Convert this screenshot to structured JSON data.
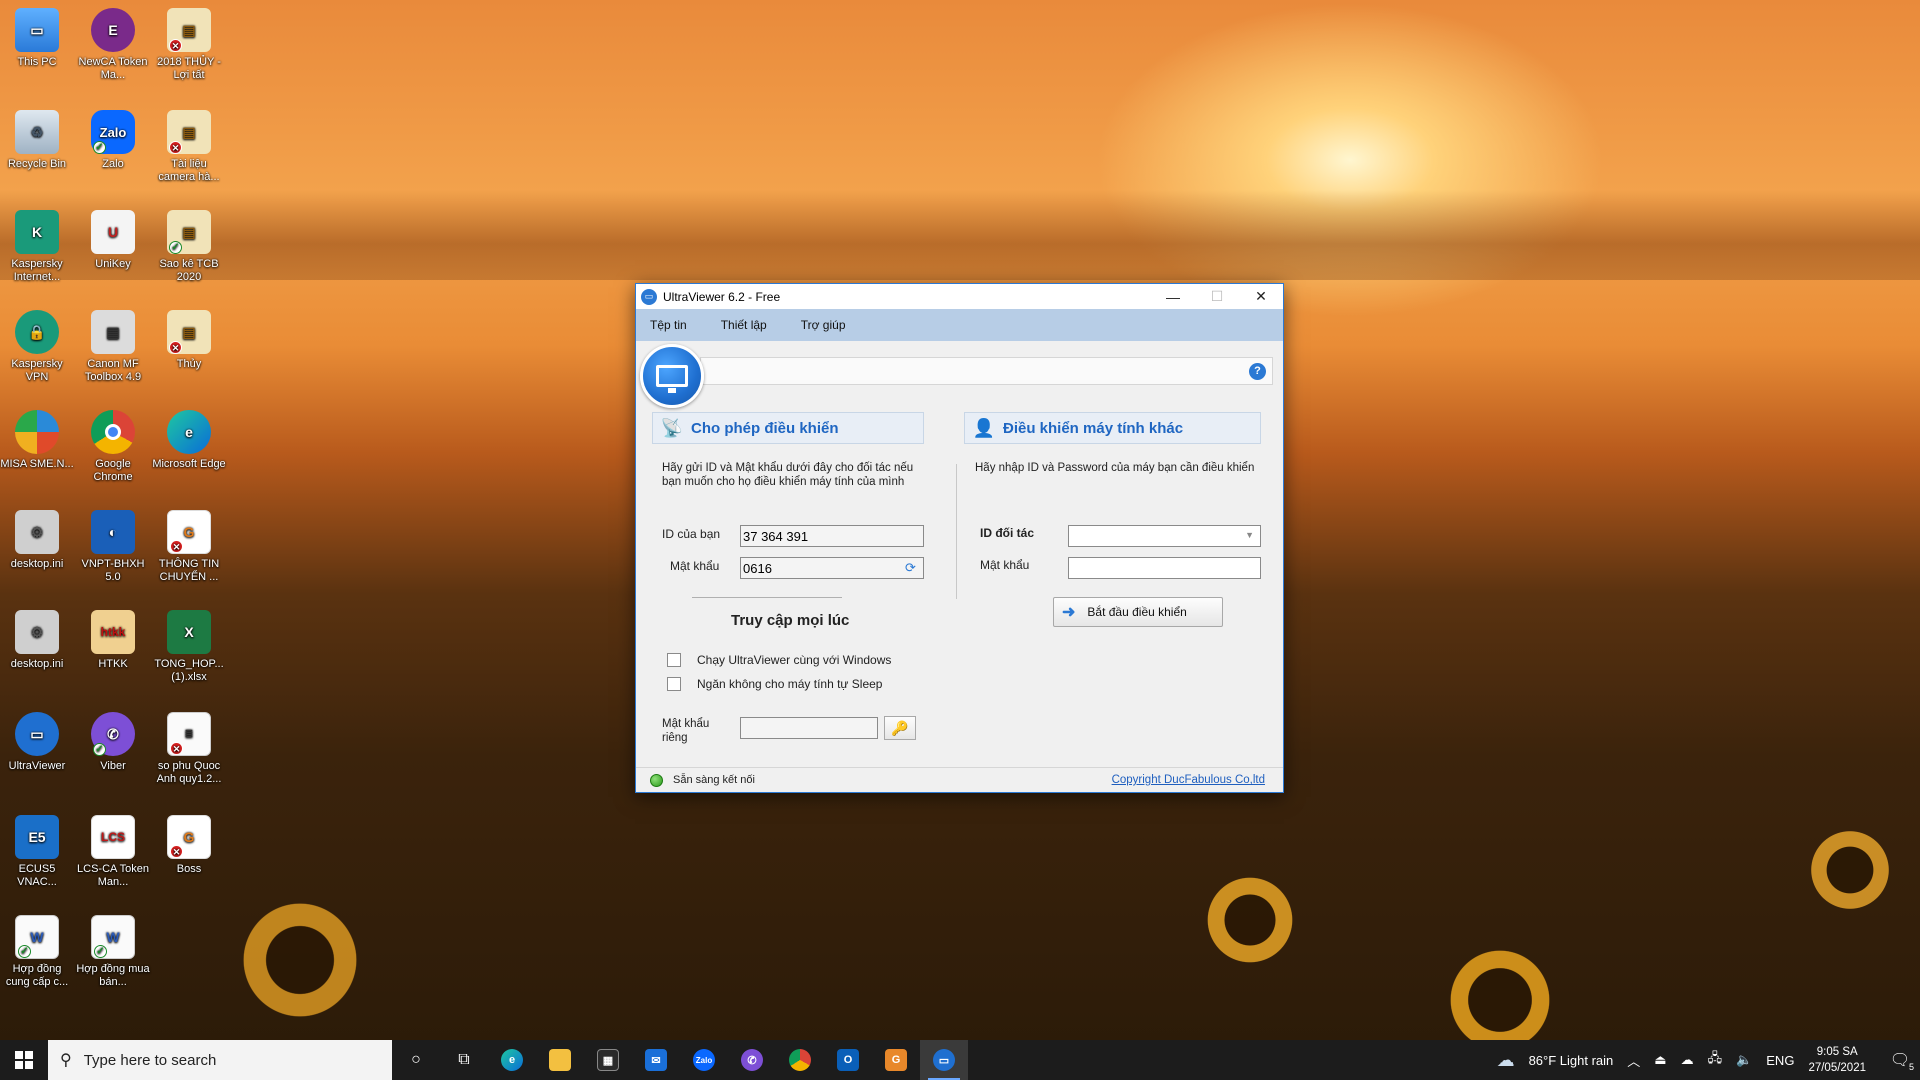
{
  "desktop": {
    "icons": [
      {
        "label": "This PC"
      },
      {
        "label": "NewCA Token Ma..."
      },
      {
        "label": "2018 THỦY - Lợi tất"
      },
      {
        "label": "Recycle Bin"
      },
      {
        "label": "Zalo"
      },
      {
        "label": "Tài liệu camera hà..."
      },
      {
        "label": "Kaspersky Internet..."
      },
      {
        "label": "UniKey"
      },
      {
        "label": "Sao kê TCB 2020"
      },
      {
        "label": "Kaspersky VPN"
      },
      {
        "label": "Canon MF Toolbox 4.9"
      },
      {
        "label": "Thủy"
      },
      {
        "label": "MISA SME.N..."
      },
      {
        "label": "Google Chrome"
      },
      {
        "label": "Microsoft Edge"
      },
      {
        "label": "desktop.ini"
      },
      {
        "label": "VNPT-BHXH 5.0"
      },
      {
        "label": "THÔNG TIN CHUYỂN ..."
      },
      {
        "label": "desktop.ini"
      },
      {
        "label": "HTKK"
      },
      {
        "label": "TONG_HOP... (1).xlsx"
      },
      {
        "label": "UltraViewer"
      },
      {
        "label": "Viber"
      },
      {
        "label": "so phu Quoc Anh quy1.2..."
      },
      {
        "label": "ECUS5 VNAC..."
      },
      {
        "label": "LCS-CA Token Man..."
      },
      {
        "label": "Boss"
      },
      {
        "label": "Hợp đồng cung cấp c..."
      },
      {
        "label": "Hợp đồng mua bán..."
      }
    ]
  },
  "window": {
    "title": "UltraViewer 6.2 - Free",
    "menu": [
      "Tệp tin",
      "Thiết lập",
      "Trợ giúp"
    ],
    "left_panel": {
      "heading": "Cho phép điều khiển",
      "description": "Hãy gửi ID và Mật khẩu dưới đây cho đối tác nếu bạn muốn cho họ điều khiển máy tính của mình",
      "id_label": "ID của bạn",
      "id_value": "37 364 391",
      "password_label": "Mật khẩu",
      "password_value": "0616"
    },
    "right_panel": {
      "heading": "Điều khiển máy tính khác",
      "description": "Hãy nhập ID và Password của máy bạn cần điều khiển",
      "partner_id_label": "ID đối tác",
      "partner_id_value": "",
      "password_label": "Mật khẩu",
      "password_value": "",
      "start_button": "Bắt đầu điều khiển"
    },
    "anytime": {
      "title": "Truy cập mọi lúc",
      "option1": "Chạy UltraViewer cùng với Windows",
      "option2": "Ngăn không cho máy tính tự Sleep",
      "private_pw_label": "Mật khẩu riêng",
      "private_pw_value": ""
    },
    "status": {
      "text": "Sẵn sàng kết nối",
      "copyright": "Copyright DucFabulous Co,ltd",
      "indicator_color": "#2a9a1a"
    }
  },
  "taskbar": {
    "search_placeholder": "Type here to search",
    "weather": "86°F  Light rain",
    "language": "ENG",
    "time": "9:05 SA",
    "date": "27/05/2021",
    "notification_count": "5"
  }
}
